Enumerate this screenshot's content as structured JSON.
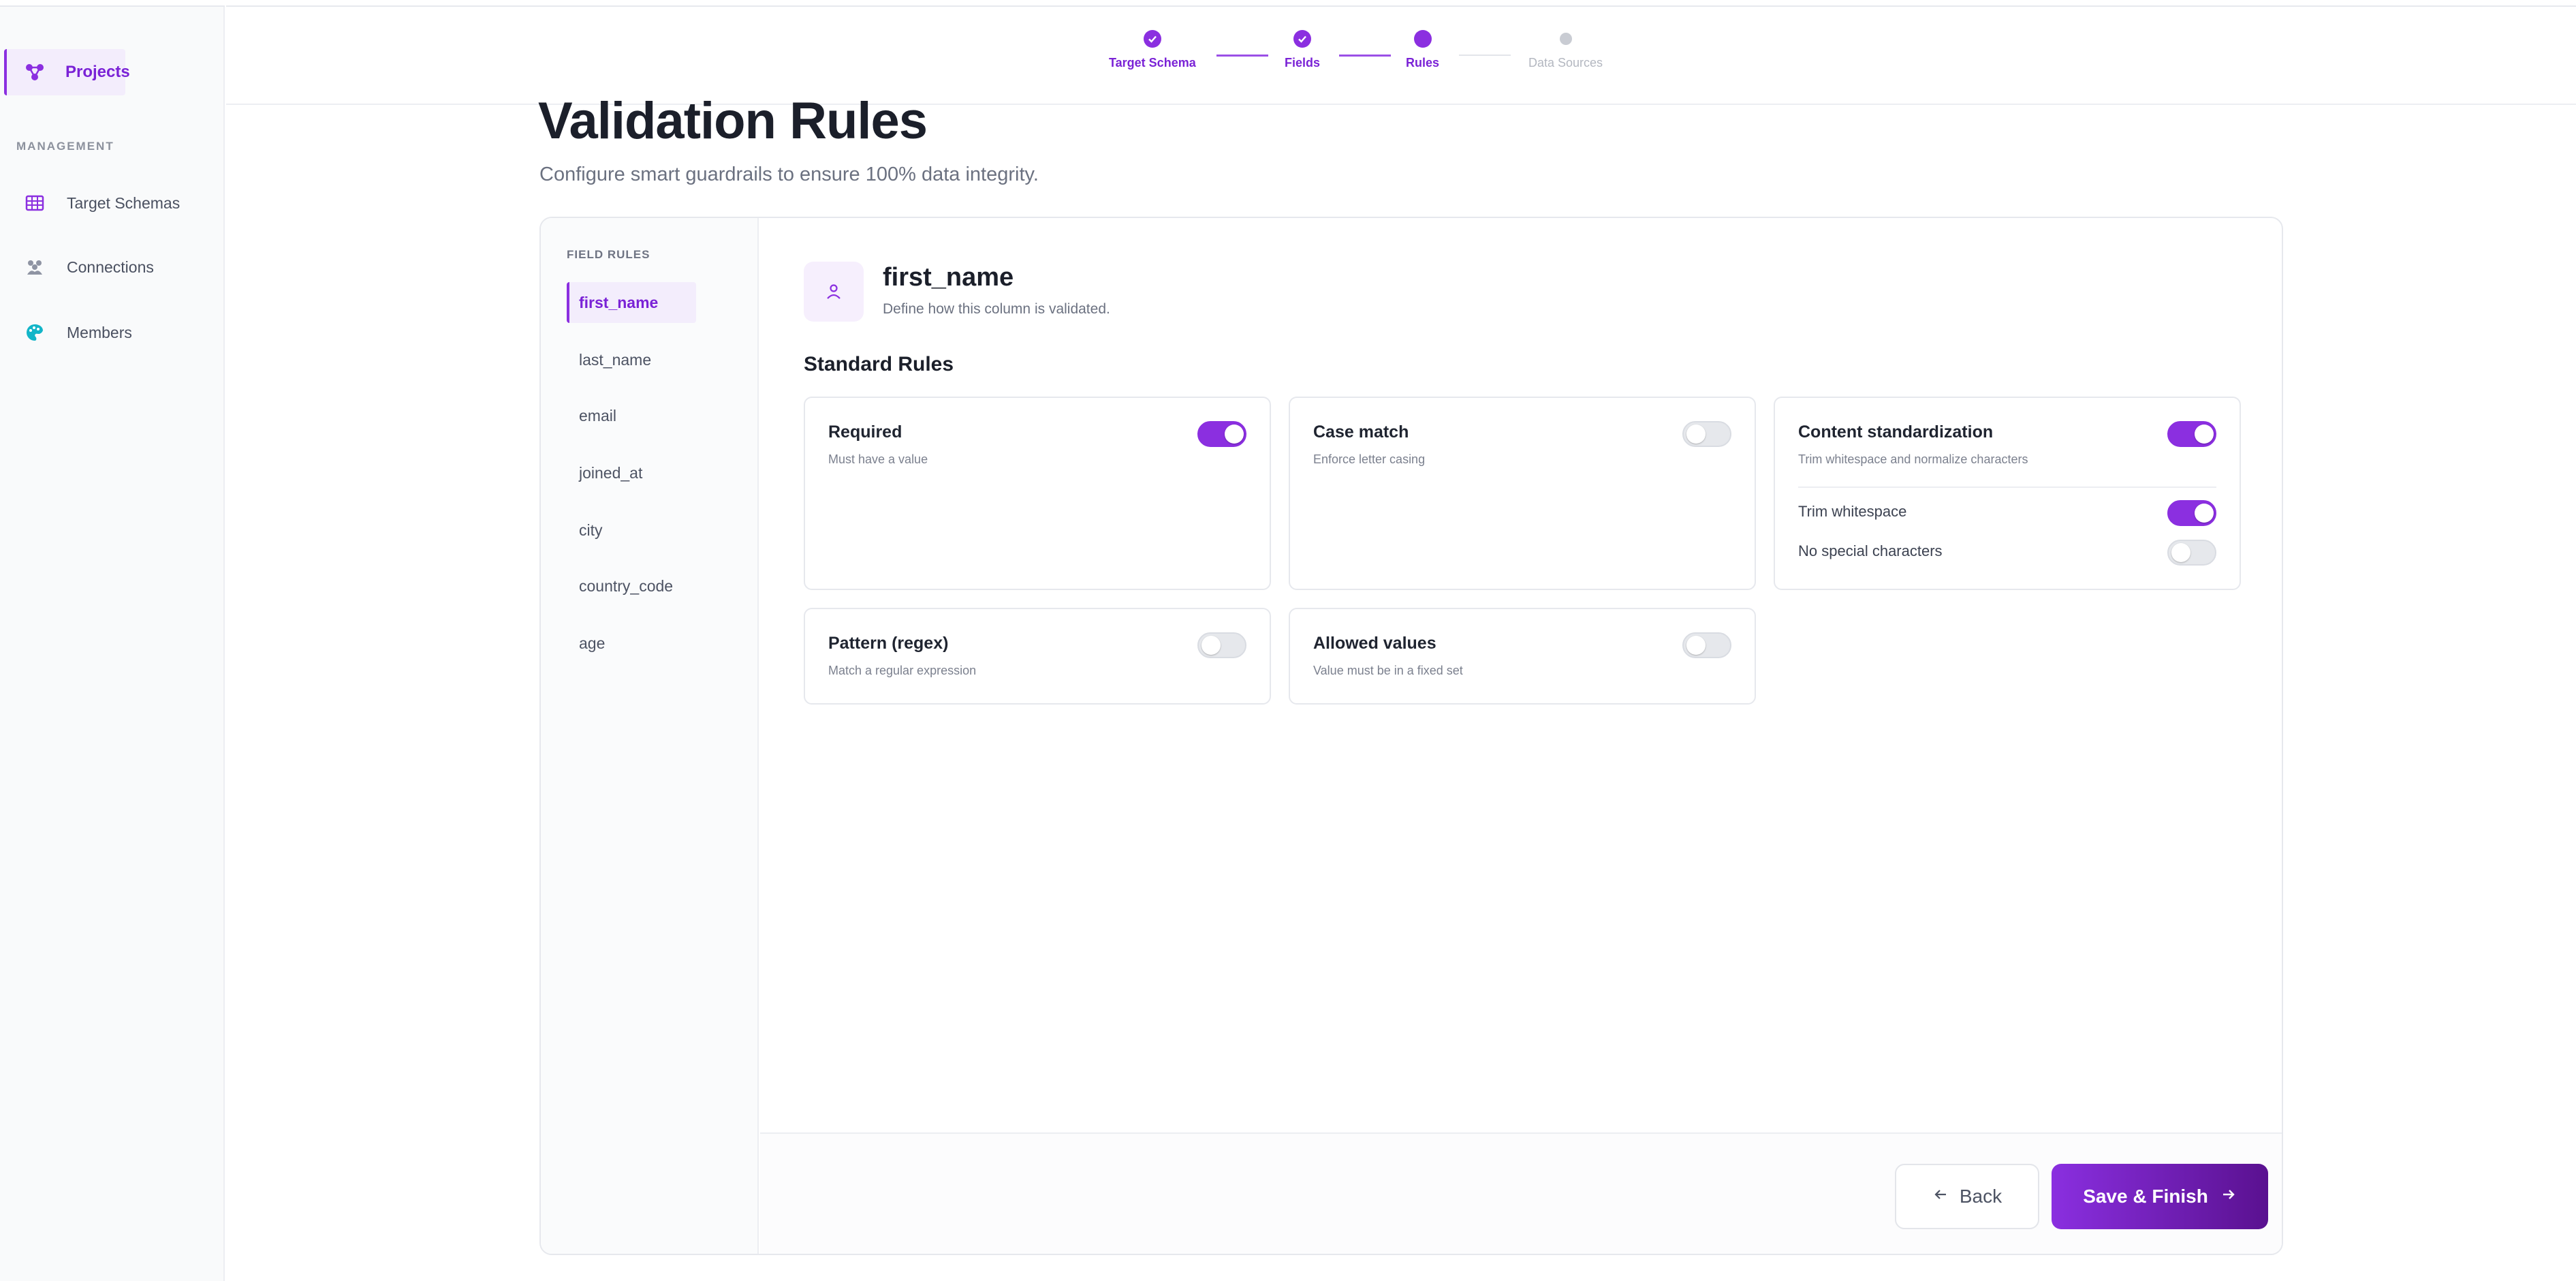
{
  "sidebar": {
    "active_item": "Projects",
    "section_label": "MANAGEMENT",
    "items": [
      "Target Schemas",
      "Connections",
      "Members"
    ]
  },
  "stepper": {
    "steps": [
      {
        "label": "Target Schema",
        "state": "done"
      },
      {
        "label": "Fields",
        "state": "done"
      },
      {
        "label": "Rules",
        "state": "current"
      },
      {
        "label": "Data Sources",
        "state": "pending"
      }
    ]
  },
  "page": {
    "title": "Validation Rules",
    "subtitle": "Configure smart guardrails to ensure 100% data integrity."
  },
  "fields_panel": {
    "title": "FIELD RULES",
    "fields": [
      "first_name",
      "last_name",
      "email",
      "joined_at",
      "city",
      "country_code",
      "age"
    ],
    "selected": "first_name"
  },
  "column": {
    "name": "first_name",
    "description": "Define how this column is validated.",
    "rules_heading": "Standard Rules"
  },
  "rules": [
    {
      "title": "Required",
      "description": "Must have a value",
      "enabled": true
    },
    {
      "title": "Case match",
      "description": "Enforce letter casing",
      "enabled": false
    },
    {
      "title": "Content standardization",
      "description": "Trim whitespace and normalize characters",
      "enabled": true,
      "options": [
        {
          "label": "Trim whitespace",
          "enabled": true
        },
        {
          "label": "No special characters",
          "enabled": false
        }
      ]
    },
    {
      "title": "Pattern (regex)",
      "description": "Match a regular expression",
      "enabled": false
    },
    {
      "title": "Allowed values",
      "description": "Value must be in a fixed set",
      "enabled": false
    }
  ],
  "footer": {
    "back_label": "Back",
    "save_label": "Save & Finish"
  },
  "colors": {
    "accent": "#8b2fe0",
    "accent_dark": "#5a1190",
    "members_icon": "#13b5c8"
  },
  "icons": {
    "projects": "projects-icon",
    "target_schemas": "table-grid-icon",
    "connections": "users-group-icon",
    "members": "palette-icon",
    "column": "user-icon",
    "step_done": "check-icon",
    "back": "arrow-left-icon",
    "save": "arrow-right-icon"
  }
}
